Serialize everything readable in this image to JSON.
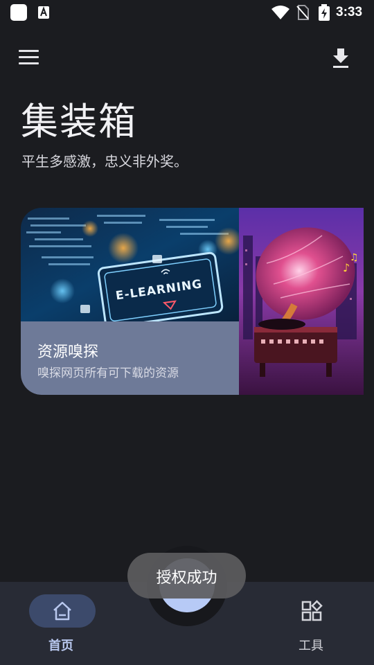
{
  "status_bar": {
    "time": "3:33",
    "icons": [
      "app-square-icon",
      "text-a-icon",
      "wifi-icon",
      "no-sim-icon",
      "battery-charging-icon"
    ]
  },
  "top_bar": {
    "menu_icon": "menu-icon",
    "download_icon": "download-icon"
  },
  "header": {
    "title": "集装箱",
    "subtitle": "平生多感激，忠义非外奖。"
  },
  "card": {
    "image_text": "E-LEARNING",
    "title": "资源嗅探",
    "description": "嗅探网页所有可下载的资源"
  },
  "bottom_nav": {
    "items": [
      {
        "label": "首页",
        "icon": "home-icon",
        "selected": true
      },
      {
        "label": "工具",
        "icon": "tools-grid-icon",
        "selected": false
      }
    ]
  },
  "toast": {
    "text": "授权成功"
  },
  "colors": {
    "background": "#1b1c20",
    "card_body": "#6e7a98",
    "nav_background": "#282b35",
    "nav_selected_pill": "#3c4a6b",
    "fab": "#b7caf6"
  }
}
